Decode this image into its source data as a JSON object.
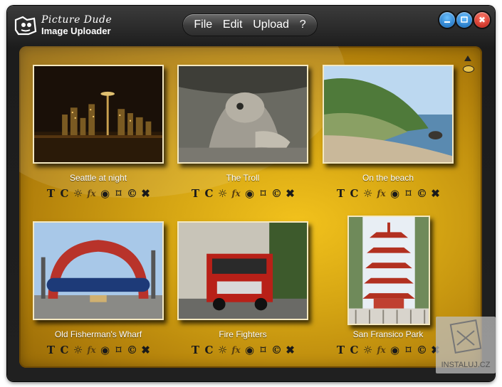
{
  "app": {
    "brand_line1": "Picture Dude",
    "brand_line2": "Image Uploader"
  },
  "menu": {
    "file": "File",
    "edit": "Edit",
    "upload": "Upload",
    "help": "?"
  },
  "window_controls": {
    "minimize_icon": "minimize-icon",
    "maximize_icon": "maximize-icon",
    "close_icon": "close-icon",
    "close_glyph": "✖"
  },
  "photos": [
    {
      "caption": "Seattle at night"
    },
    {
      "caption": "The Troll"
    },
    {
      "caption": "On the beach"
    },
    {
      "caption": "Old Fisherman's Wharf"
    },
    {
      "caption": "Fire Fighters"
    },
    {
      "caption": "San Fransico Park"
    }
  ],
  "tool_glyphs": {
    "text": "T",
    "rotate": "C",
    "brightness": "☼",
    "effects": "fx",
    "redeye": "◉",
    "crop": "⌑",
    "copyright": "©",
    "remove": "✖"
  },
  "scroll": {
    "up_icon": "scroll-up-icon"
  },
  "watermark": {
    "text": "INSTALUJ.CZ"
  },
  "colors": {
    "panel_gold": "#d4a413",
    "window_dark": "#1c1c1c",
    "minimize_blue": "#0d5fb0",
    "close_red": "#b8160c"
  }
}
